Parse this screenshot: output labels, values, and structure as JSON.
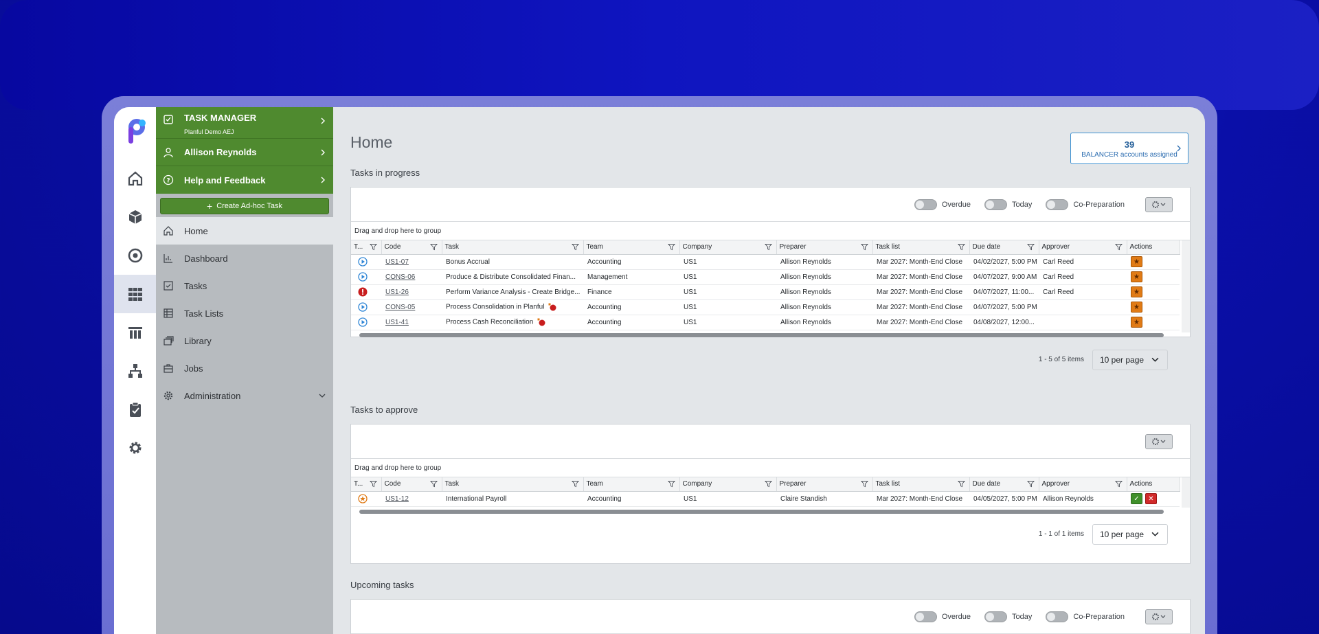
{
  "menu": {
    "app_title": "TASK MANAGER",
    "app_subtitle": "Planful Demo AEJ",
    "user_name": "Allison Reynolds",
    "help_label": "Help and Feedback",
    "adhoc_label": "Create Ad-hoc Task",
    "nav": [
      {
        "label": "Home",
        "icon": "home-icon"
      },
      {
        "label": "Dashboard",
        "icon": "chart-icon"
      },
      {
        "label": "Tasks",
        "icon": "checkbox-icon"
      },
      {
        "label": "Task Lists",
        "icon": "table-icon"
      },
      {
        "label": "Library",
        "icon": "library-icon"
      },
      {
        "label": "Jobs",
        "icon": "briefcase-icon"
      },
      {
        "label": "Administration",
        "icon": "gear-icon"
      }
    ]
  },
  "home": {
    "title": "Home",
    "balancer_count": "39",
    "balancer_label": "BALANCER accounts assigned"
  },
  "toggles": {
    "overdue": "Overdue",
    "today": "Today",
    "coprep": "Co-Preparation"
  },
  "group_bar": "Drag and drop here to group",
  "columns": [
    "T...",
    "Code",
    "Task",
    "Team",
    "Company",
    "Preparer",
    "Task list",
    "Due date",
    "Approver",
    "Actions"
  ],
  "in_progress": {
    "title": "Tasks in progress",
    "rows": [
      {
        "status": "play",
        "code": "US1-07",
        "task": "Bonus Accrual",
        "team": "Accounting",
        "company": "US1",
        "preparer": "Allison Reynolds",
        "tasklist": "Mar 2027: Month-End Close",
        "due": "04/02/2027, 5:00 PM",
        "approver": "Carl Reed"
      },
      {
        "status": "play",
        "code": "CONS-06",
        "task": "Produce & Distribute Consolidated Finan...",
        "team": "Management",
        "company": "US1",
        "preparer": "Allison Reynolds",
        "tasklist": "Mar 2027: Month-End Close",
        "due": "04/07/2027, 9:00 AM",
        "approver": "Carl Reed"
      },
      {
        "status": "alert",
        "code": "US1-26",
        "task": "Perform Variance Analysis - Create Bridge...",
        "team": "Finance",
        "company": "US1",
        "preparer": "Allison Reynolds",
        "tasklist": "Mar 2027: Month-End Close",
        "due": "04/07/2027, 11:00...",
        "approver": "Carl Reed"
      },
      {
        "status": "play",
        "code": "CONS-05",
        "task": "Process Consolidation in Planful",
        "team": "Accounting",
        "company": "US1",
        "preparer": "Allison Reynolds",
        "tasklist": "Mar 2027: Month-End Close",
        "due": "04/07/2027, 5:00 PM",
        "approver": ""
      },
      {
        "status": "play",
        "code": "US1-41",
        "task": "Process Cash Reconciliation",
        "team": "Accounting",
        "company": "US1",
        "preparer": "Allison Reynolds",
        "tasklist": "Mar 2027: Month-End Close",
        "due": "04/08/2027, 12:00...",
        "approver": ""
      }
    ],
    "pager_text": "1 - 5 of 5 items",
    "per_page": "10 per page"
  },
  "to_approve": {
    "title": "Tasks to approve",
    "rows": [
      {
        "status": "star",
        "code": "US1-12",
        "task": "International Payroll",
        "team": "Accounting",
        "company": "US1",
        "preparer": "Claire Standish",
        "tasklist": "Mar 2027: Month-End Close",
        "due": "04/05/2027, 5:00 PM",
        "approver": "Allison Reynolds"
      }
    ],
    "pager_text": "1 - 1 of 1 items",
    "per_page": "10 per page"
  },
  "upcoming": {
    "title": "Upcoming tasks"
  }
}
